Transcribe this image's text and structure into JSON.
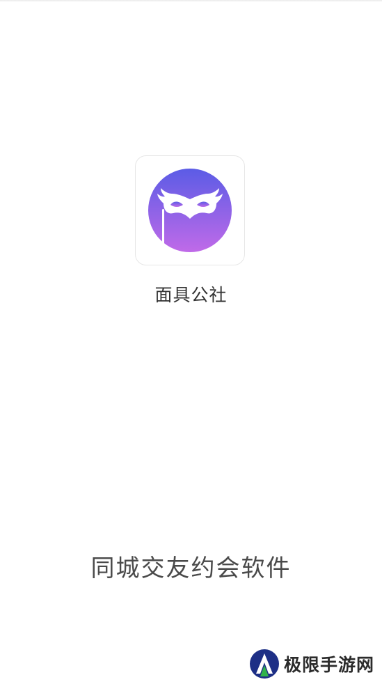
{
  "splash": {
    "app_icon": "mask-logo-icon",
    "app_name": "面具公社",
    "tagline": "同城交友约会软件"
  },
  "watermark": {
    "logo_icon": "site-logo-icon",
    "text": "极限手游网"
  },
  "colors": {
    "background": "#ffffff",
    "icon_gradient_top": "#5b5ce6",
    "icon_gradient_bottom": "#c06ae8",
    "mask": "#ffffff",
    "watermark_logo_blue": "#1d2f86",
    "watermark_logo_green": "#2fb34a"
  }
}
